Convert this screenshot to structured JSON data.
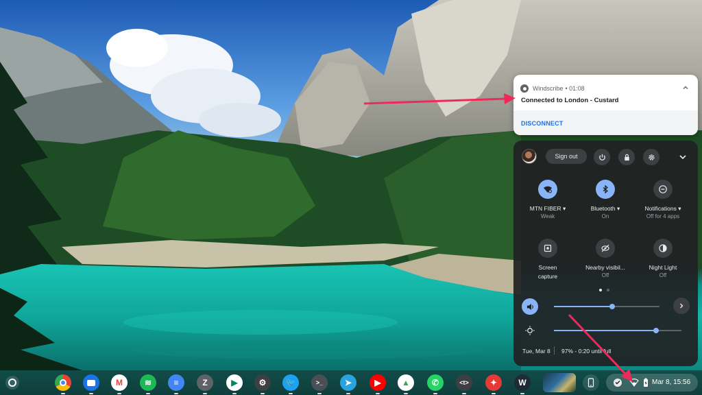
{
  "notification": {
    "app_name": "Windscribe",
    "time": "• 01:08",
    "message": "Connected to London - Custard",
    "action_label": "DISCONNECT"
  },
  "quick_settings": {
    "sign_out_label": "Sign out",
    "tiles": [
      {
        "label": "MTN FIBER ▾",
        "sub": "Weak",
        "state": "on",
        "icon": "wifi-icon"
      },
      {
        "label": "Bluetooth ▾",
        "sub": "On",
        "state": "on",
        "icon": "bluetooth-icon"
      },
      {
        "label": "Notifications ▾",
        "sub": "Off for 4 apps",
        "state": "off",
        "icon": "do-not-disturb-icon"
      },
      {
        "label": "Screen",
        "sub": "capture",
        "state": "off",
        "icon": "screen-capture-icon"
      },
      {
        "label": "Nearby visibil...",
        "sub": "Off",
        "state": "off",
        "icon": "nearby-share-icon"
      },
      {
        "label": "Night Light",
        "sub": "Off",
        "state": "off",
        "icon": "night-light-icon"
      }
    ],
    "volume_level": 0.55,
    "brightness_level": 0.8,
    "page_count": 2,
    "active_page": 1,
    "footer_date": "Tue, Mar 8",
    "footer_battery": "97% - 0:20 until full"
  },
  "shelf": {
    "apps": [
      {
        "name": "chrome-app",
        "glyph": "",
        "color": "#ffffff"
      },
      {
        "name": "files-app",
        "glyph": "",
        "color": "#1a73e8"
      },
      {
        "name": "gmail-app",
        "glyph": "M",
        "color": "#ffffff"
      },
      {
        "name": "spotify-app",
        "glyph": "≋",
        "color": "#1db954"
      },
      {
        "name": "docs-app",
        "glyph": "≡",
        "color": "#4285f4"
      },
      {
        "name": "zoom-app",
        "glyph": "Z",
        "color": "#5f6368"
      },
      {
        "name": "play-store-app",
        "glyph": "▶",
        "color": "#ffffff"
      },
      {
        "name": "settings-app",
        "glyph": "⚙",
        "color": "#3c4043"
      },
      {
        "name": "twitter-app",
        "glyph": "🐦",
        "color": "#1da1f2"
      },
      {
        "name": "terminal-app",
        "glyph": ">_",
        "color": "#4a4f55"
      },
      {
        "name": "telegram-app",
        "glyph": "➤",
        "color": "#2aa3df"
      },
      {
        "name": "youtube-app",
        "glyph": "▶",
        "color": "#ff0000"
      },
      {
        "name": "drive-app",
        "glyph": "▲",
        "color": "#ffffff"
      },
      {
        "name": "whatsapp-app",
        "glyph": "✆",
        "color": "#25d366"
      },
      {
        "name": "text-app",
        "glyph": "<t>",
        "color": "#3c4043"
      },
      {
        "name": "screenshot-app",
        "glyph": "✦",
        "color": "#e53935"
      },
      {
        "name": "windscribe-app",
        "glyph": "W",
        "color": "#1f2a36"
      }
    ],
    "status_time": "Mar 8, 15:56"
  }
}
